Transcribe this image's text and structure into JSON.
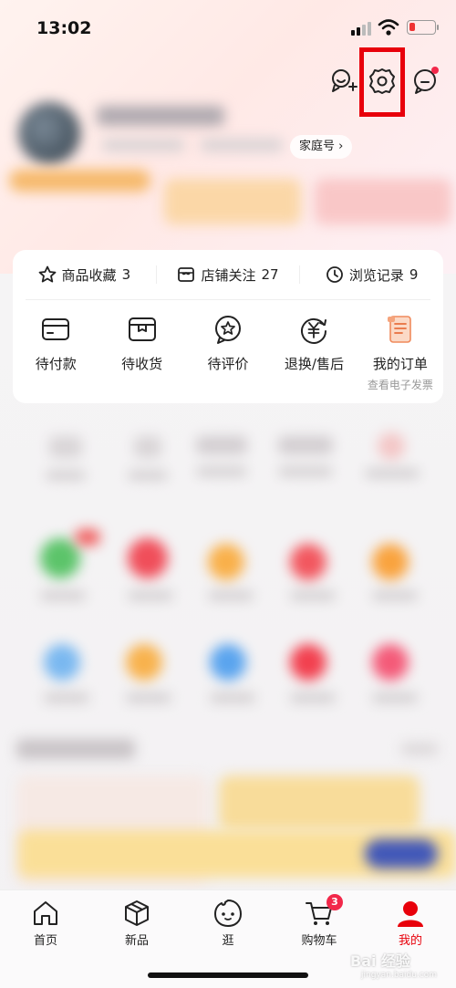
{
  "status_bar": {
    "time": "13:02"
  },
  "header": {
    "icons": [
      "add-friend-icon",
      "settings-icon",
      "message-icon"
    ],
    "family_tag": "家庭号 ›"
  },
  "stats": [
    {
      "icon": "star-icon",
      "label": "商品收藏",
      "count": "3"
    },
    {
      "icon": "store-icon",
      "label": "店铺关注",
      "count": "27"
    },
    {
      "icon": "clock-icon",
      "label": "浏览记录",
      "count": "9"
    }
  ],
  "orders": [
    {
      "icon": "wallet-icon",
      "label": "待付款"
    },
    {
      "icon": "box-icon",
      "label": "待收货"
    },
    {
      "icon": "review-icon",
      "label": "待评价"
    },
    {
      "icon": "refund-icon",
      "label": "退换/售后"
    },
    {
      "icon": "order-list-icon",
      "label": "我的订单",
      "sub": "查看电子发票"
    }
  ],
  "tabbar": {
    "tabs": [
      {
        "icon": "home-icon",
        "label": "首页"
      },
      {
        "icon": "cube-icon",
        "label": "新品"
      },
      {
        "icon": "face-icon",
        "label": "逛"
      },
      {
        "icon": "cart-icon",
        "label": "购物车",
        "badge": "3"
      },
      {
        "icon": "profile-icon",
        "label": "我的",
        "active": true
      }
    ],
    "active_color": "#e8000b"
  },
  "watermark": {
    "main": "Bai 经验",
    "sub": "jingyan.baidu.com"
  },
  "colors": {
    "highlight": "#e8000b",
    "badge": "#f2284a"
  }
}
